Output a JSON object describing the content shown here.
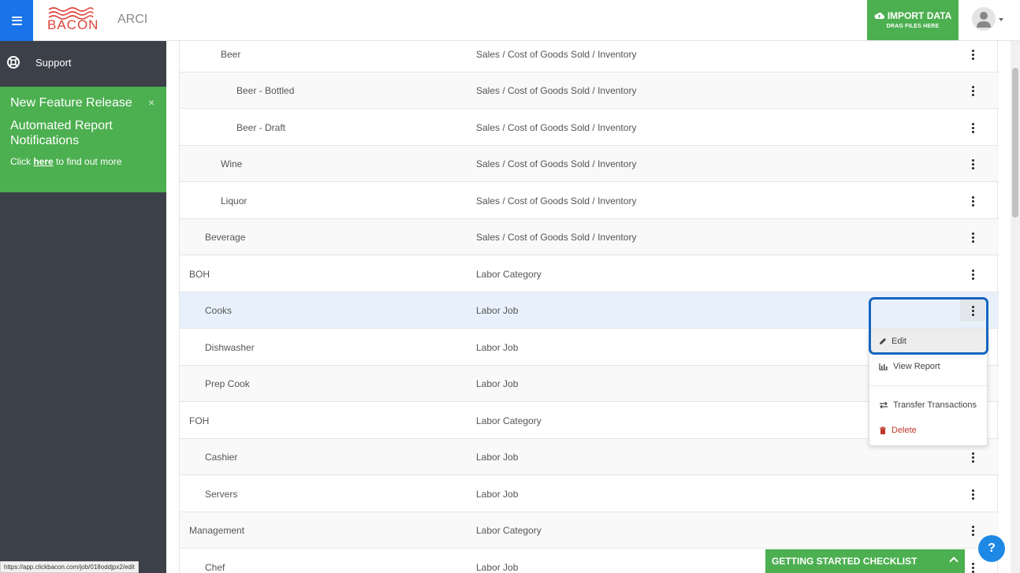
{
  "header": {
    "logo_text": "BACON",
    "app_title": "ARCI",
    "import_label": "IMPORT DATA",
    "import_sub": "DRAG FILES HERE"
  },
  "sidebar": {
    "support_label": "Support",
    "promo": {
      "title": "New Feature Release",
      "subtitle": "Automated Report Notifications",
      "link_prefix": "Click ",
      "link_text": "here",
      "link_suffix": " to find out more",
      "close": "×"
    }
  },
  "rows": [
    {
      "name": "Beer",
      "type": "Sales / Cost of Goods Sold / Inventory"
    },
    {
      "name": "Beer - Bottled",
      "type": "Sales / Cost of Goods Sold / Inventory"
    },
    {
      "name": "Beer - Draft",
      "type": "Sales / Cost of Goods Sold / Inventory"
    },
    {
      "name": "Wine",
      "type": "Sales / Cost of Goods Sold / Inventory"
    },
    {
      "name": "Liquor",
      "type": "Sales / Cost of Goods Sold / Inventory"
    },
    {
      "name": "Beverage",
      "type": "Sales / Cost of Goods Sold / Inventory"
    },
    {
      "name": "BOH",
      "type": "Labor Category"
    },
    {
      "name": "Cooks",
      "type": "Labor Job"
    },
    {
      "name": "Dishwasher",
      "type": "Labor Job"
    },
    {
      "name": "Prep Cook",
      "type": "Labor Job"
    },
    {
      "name": "FOH",
      "type": "Labor Category"
    },
    {
      "name": "Cashier",
      "type": "Labor Job"
    },
    {
      "name": "Servers",
      "type": "Labor Job"
    },
    {
      "name": "Management",
      "type": "Labor Category"
    },
    {
      "name": "Chef",
      "type": "Labor Job"
    }
  ],
  "menu": {
    "edit": "Edit",
    "view_report": "View Report",
    "transfer": "Transfer Transactions",
    "delete": "Delete"
  },
  "checklist_label": "GETTING STARTED CHECKLIST",
  "help_label": "?",
  "status_url": "https://app.clickbacon.com/job/018oddjpx2/edit",
  "colors": {
    "accent_blue": "#1a73e8",
    "green": "#4caf50",
    "sidebar_bg": "#3c4149",
    "delete_red": "#c0392b",
    "focus_ring": "#1565c0"
  }
}
